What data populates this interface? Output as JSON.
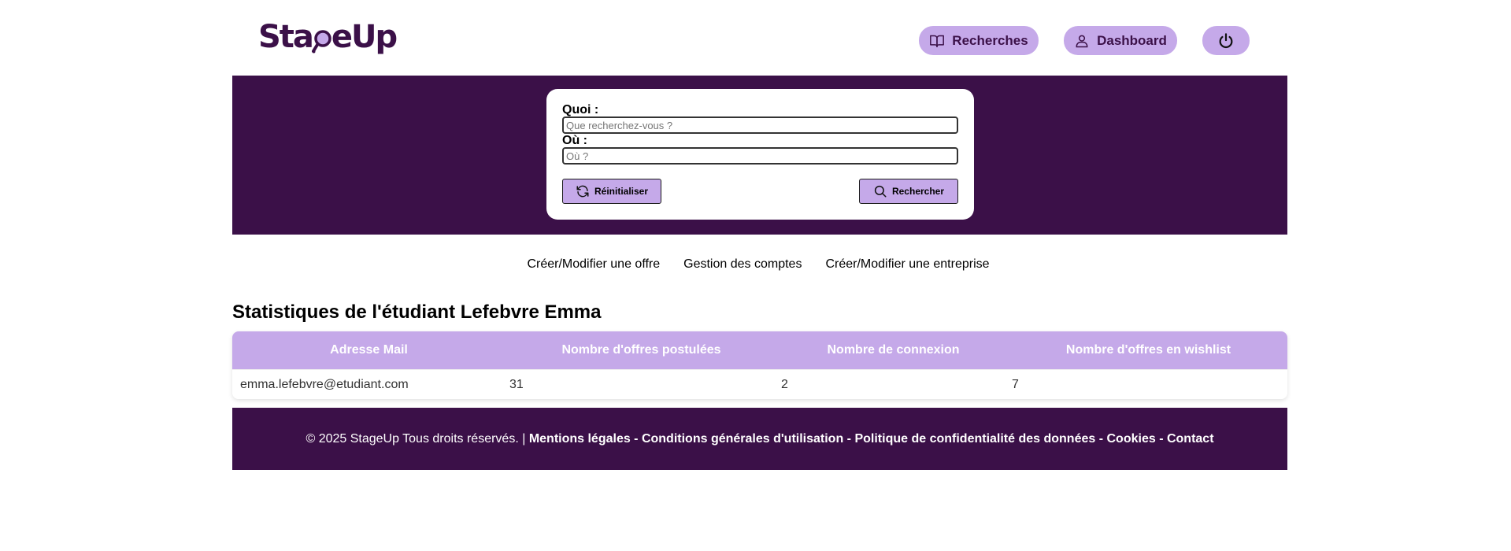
{
  "brand": {
    "logo_prefix": "Sta",
    "logo_suffix": "eUp",
    "logo_color": "#3b1048",
    "accent_color": "#c5a9e9"
  },
  "nav": {
    "recherches_label": "Recherches",
    "recherches_icon": "book-open-icon",
    "dashboard_label": "Dashboard",
    "dashboard_icon": "user-icon",
    "logout_icon": "power-icon"
  },
  "search": {
    "what_label": "Quoi :",
    "what_placeholder": "Que recherchez-vous ?",
    "what_value": "",
    "where_label": "Où :",
    "where_placeholder": "Où ?",
    "where_value": "",
    "reset_label": "Réinitialiser",
    "reset_icon": "refresh-icon",
    "submit_label": "Rechercher",
    "submit_icon": "search-icon"
  },
  "subnav": {
    "items": [
      {
        "label": "Créer/Modifier une offre"
      },
      {
        "label": "Gestion des comptes"
      },
      {
        "label": "Créer/Modifier une entreprise"
      }
    ]
  },
  "stats": {
    "title": "Statistiques de l'étudiant Lefebvre Emma",
    "columns": [
      "Adresse Mail",
      "Nombre d'offres postulées",
      "Nombre de connexion",
      "Nombre d'offres en wishlist"
    ],
    "rows": [
      [
        "emma.lefebvre@etudiant.com",
        "31",
        "2",
        "7"
      ]
    ]
  },
  "footer": {
    "copyright": "© 2025 StageUp Tous droits réservés. | ",
    "links": [
      "Mentions légales",
      "Conditions générales d'utilisation",
      "Politique de confidentialité des données",
      "Cookies",
      "Contact"
    ],
    "separator": " - "
  }
}
